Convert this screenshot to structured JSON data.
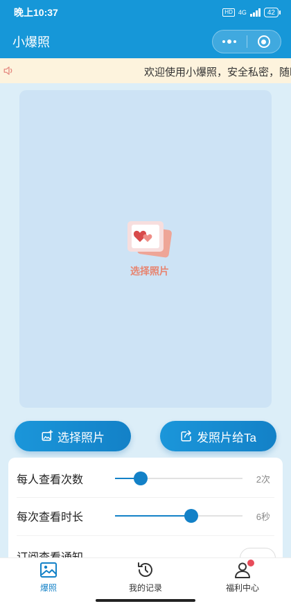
{
  "status_bar": {
    "time": "晚上10:37",
    "hd": "HD",
    "network": "4G",
    "battery": "42"
  },
  "nav": {
    "title": "小爆照"
  },
  "notice": {
    "text": "欢迎使用小爆照，安全私密，随时"
  },
  "photo_area": {
    "picker_label": "选择照片"
  },
  "actions": {
    "select_photo": "选择照片",
    "send_photo": "发照片给Ta"
  },
  "settings": {
    "views_per_person": {
      "label": "每人查看次数",
      "value": "2次",
      "level": 0.2
    },
    "view_duration": {
      "label": "每次查看时长",
      "value": "6秒",
      "level": 0.6
    },
    "subscribe": {
      "label": "订阅查看通知"
    }
  },
  "tabs": [
    {
      "label": "爆照",
      "icon": "photo-icon",
      "active": true
    },
    {
      "label": "我的记录",
      "icon": "history-icon",
      "active": false
    },
    {
      "label": "福利中心",
      "icon": "user-icon",
      "active": false
    }
  ],
  "colors": {
    "primary": "#1697d8",
    "accent": "#1381c7",
    "picker_text": "#e78571",
    "notice_bg": "#fdf3dd"
  }
}
